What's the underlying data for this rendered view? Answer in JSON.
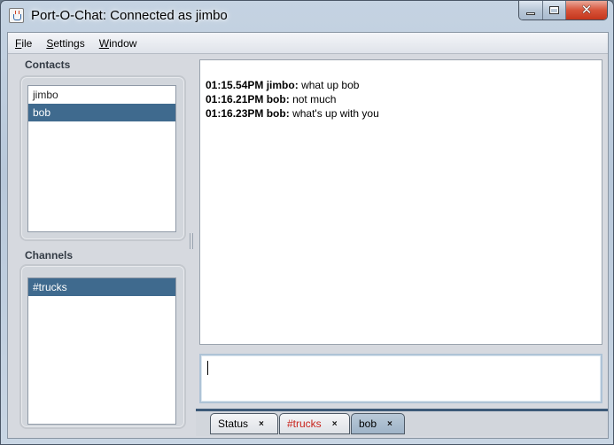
{
  "window": {
    "title": "Port-O-Chat: Connected as jimbo"
  },
  "menu": [
    {
      "mnemonic": "F",
      "rest": "ile"
    },
    {
      "mnemonic": "S",
      "rest": "ettings"
    },
    {
      "mnemonic": "W",
      "rest": "indow"
    }
  ],
  "contacts": {
    "label": "Contacts",
    "items": [
      "jimbo",
      "bob"
    ],
    "selected": "bob"
  },
  "channels": {
    "label": "Channels",
    "items": [
      "#trucks"
    ],
    "selected": "#trucks"
  },
  "chat": {
    "messages": [
      {
        "time": "01:15.54PM",
        "user": "jimbo",
        "text": "what up bob"
      },
      {
        "time": "01:16.21PM",
        "user": "bob",
        "text": "not much"
      },
      {
        "time": "01:16.23PM",
        "user": "bob",
        "text": "what's up with you"
      }
    ]
  },
  "input": {
    "value": ""
  },
  "tabs": [
    {
      "label": "Status",
      "close": "×",
      "state": "normal"
    },
    {
      "label": "#trucks",
      "close": "×",
      "state": "alert"
    },
    {
      "label": "bob",
      "close": "×",
      "state": "active"
    }
  ],
  "colors": {
    "selection": "#3f6a8e",
    "alert_tab_text": "#c8221a",
    "tab_underline": "#3d5a78"
  }
}
